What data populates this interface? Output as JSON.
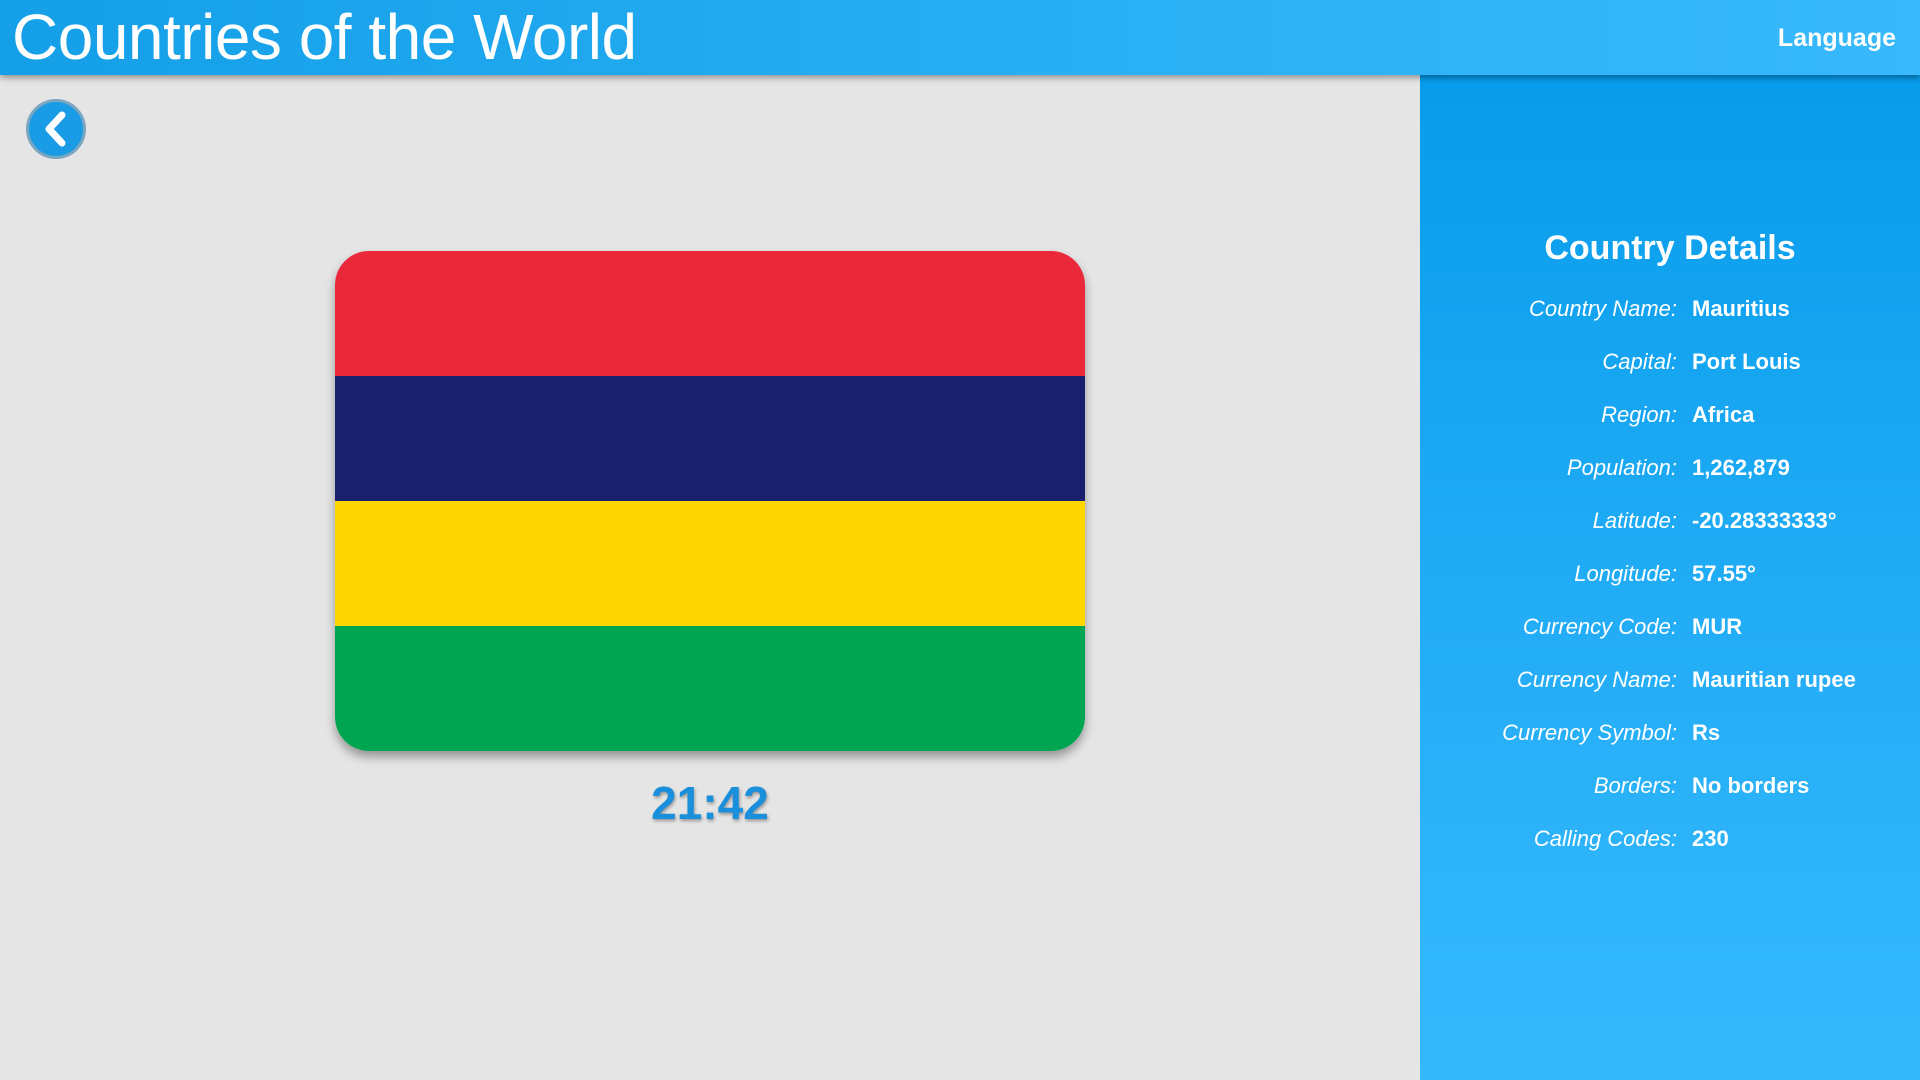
{
  "header": {
    "title": "Countries of the World",
    "language_label": "Language"
  },
  "icons": {
    "back": "chevron-left-icon"
  },
  "flag": {
    "country": "Mauritius",
    "stripes": [
      "#ea2839",
      "#1a206d",
      "#ffd600",
      "#00a551"
    ]
  },
  "timer": "21:42",
  "details": {
    "title": "Country Details",
    "rows": [
      {
        "label": "Country Name:",
        "value": "Mauritius"
      },
      {
        "label": "Capital:",
        "value": "Port Louis"
      },
      {
        "label": "Region:",
        "value": "Africa"
      },
      {
        "label": "Population:",
        "value": "1,262,879"
      },
      {
        "label": "Latitude:",
        "value": "-20.28333333°"
      },
      {
        "label": "Longitude:",
        "value": "57.55°"
      },
      {
        "label": "Currency Code:",
        "value": "MUR"
      },
      {
        "label": "Currency Name:",
        "value": "Mauritian rupee"
      },
      {
        "label": "Currency Symbol:",
        "value": "Rs"
      },
      {
        "label": "Borders:",
        "value": "No borders"
      },
      {
        "label": "Calling Codes:",
        "value": "230"
      }
    ]
  },
  "colors": {
    "accent": "#149fe8",
    "timer": "#1a8fdc",
    "background": "#e5e5e5"
  }
}
